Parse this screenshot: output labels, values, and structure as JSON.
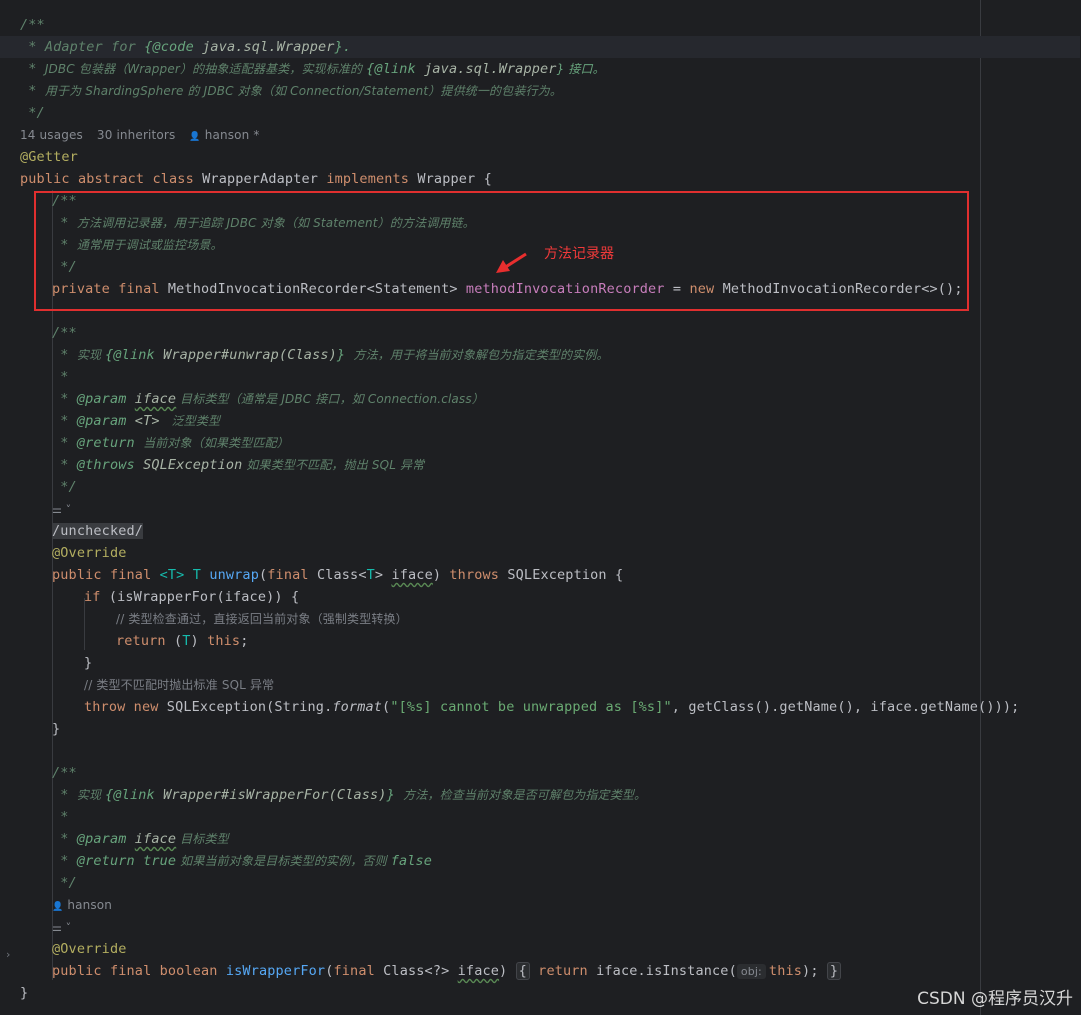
{
  "editor": {
    "language": "java",
    "colors": {
      "background": "#1e1f22",
      "keyword": "#cf8e6d",
      "annotation": "#b3ae60",
      "field": "#c77dbb",
      "method": "#56a8f5",
      "string": "#6aab73",
      "doc_comment": "#5f826b",
      "line_comment": "#7a7e85",
      "highlight_box": "#e02f2f"
    },
    "class_header": {
      "doc_open": "/**",
      "doc_line1_star": " * ",
      "doc_line1_text": "Adapter for ",
      "doc_line1_tag": "{@code ",
      "doc_line1_code": "java.sql.Wrapper",
      "doc_line1_end": "}.",
      "doc_line2_star": " * ",
      "doc_line2_text": "JDBC 包装器（Wrapper）的抽象适配器基类，实现标准的 ",
      "doc_line2_tag": "{@link ",
      "doc_line2_code": "java.sql.Wrapper",
      "doc_line2_end": "} 接口。",
      "doc_line3_star": " * ",
      "doc_line3_text": "用于为 ShardingSphere 的 JDBC 对象（如 Connection/Statement）提供统一的包装行为。",
      "doc_close": " */",
      "usages": "14 usages",
      "inheritors": "30 inheritors",
      "author": "hanson *",
      "annotation": "@Getter",
      "kw_public": "public",
      "kw_abstract": "abstract",
      "kw_class": "class",
      "class_name": "WrapperAdapter",
      "kw_implements": "implements",
      "interface_name": "Wrapper",
      "open_brace": "{"
    },
    "field_block": {
      "doc_open": "/**",
      "doc_line1_star": " * ",
      "doc_line1_text": "方法调用记录器，用于追踪 JDBC 对象（如 Statement）的方法调用链。",
      "doc_line2_star": " * ",
      "doc_line2_text": "通常用于调试或监控场景。",
      "doc_close": " */",
      "kw_private": "private",
      "kw_final": "final",
      "type": "MethodInvocationRecorder<Statement>",
      "field_name": "methodInvocationRecorder",
      "assign": " = ",
      "kw_new": "new",
      "init": "MethodInvocationRecorder<>();"
    },
    "unwrap_method": {
      "doc_open": "/**",
      "doc_l1_star": " * ",
      "doc_l1_text": "实现 ",
      "doc_l1_tag": "{@link ",
      "doc_l1_ref": "Wrapper#",
      "doc_l1_ref_method": "unwrap",
      "doc_l1_ref_param": "(Class)",
      "doc_l1_end": "} ",
      "doc_l1_tail": "方法，用于将当前对象解包为指定类型的实例。",
      "doc_blank": " *",
      "doc_p1_star": " * ",
      "doc_p1_tag": "@param ",
      "doc_p1_name": "iface",
      "doc_p1_desc": " 目标类型（通常是 JDBC 接口，如 Connection.class）",
      "doc_p2_star": " * ",
      "doc_p2_tag": "@param ",
      "doc_p2_name": "<T>",
      "doc_p2_desc": "   泛型类型",
      "doc_r_star": " * ",
      "doc_r_tag": "@return ",
      "doc_r_desc": "当前对象（如果类型匹配）",
      "doc_t_star": " * ",
      "doc_t_tag": "@throws ",
      "doc_t_name": "SQLException",
      "doc_t_desc": " 如果类型不匹配，抛出 SQL 异常",
      "doc_close": " */",
      "lens": "⚌ ˅",
      "suppress": "/unchecked/",
      "annotation": "@Override",
      "kw_public": "public",
      "kw_final": "final",
      "type_param": "<T>",
      "ret_type": "T",
      "name": "unwrap",
      "paren_open": "(",
      "param_kw_final": "final",
      "param_type_a": "Class<",
      "param_type_t": "T",
      "param_type_b": "> ",
      "param_name": "iface",
      "paren_close": ")",
      "kw_throws": "throws",
      "exception": "SQLException {",
      "if_kw": "if",
      "if_cond": " (isWrapperFor(iface)) {",
      "comment1": "// 类型检查通过，直接返回当前对象（强制类型转换）",
      "return_kw": "return",
      "return_cast_a": " (",
      "return_cast_t": "T",
      "return_cast_b": ") ",
      "this_kw": "this",
      "semicolon": ";",
      "close_if": "}",
      "comment2": "// 类型不匹配时抛出标准 SQL 异常",
      "throw_kw": "throw",
      "new_kw": "new",
      "throw_a": "SQLException(String.",
      "throw_format": "format",
      "throw_b": "(",
      "throw_str": "\"[%s] cannot be unwrapped as [%s]\"",
      "throw_c": ", getClass().getName(), iface.getName()));",
      "close_method": "}"
    },
    "is_wrapper_for_method": {
      "doc_open": "/**",
      "doc_l1_star": " * ",
      "doc_l1_text": "实现 ",
      "doc_l1_tag": "{@link ",
      "doc_l1_ref": "Wrapper#",
      "doc_l1_ref_method": "isWrapperFor",
      "doc_l1_ref_param": "(Class)",
      "doc_l1_end": "} ",
      "doc_l1_tail": "方法，检查当前对象是否可解包为指定类型。",
      "doc_blank": " *",
      "doc_p_star": " * ",
      "doc_p_tag": "@param ",
      "doc_p_name": "iface",
      "doc_p_desc": " 目标类型",
      "doc_r_star": " * ",
      "doc_r_tag": "@return ",
      "doc_r_val": "true",
      "doc_r_desc": " 如果当前对象是目标类型的实例，否则 ",
      "doc_r_val2": "false",
      "doc_close": " */",
      "author": "hanson",
      "lens": "⚌ ˅",
      "annotation": "@Override",
      "kw_public": "public",
      "kw_final": "final",
      "kw_boolean": "boolean",
      "name": "isWrapperFor",
      "paren_open": "(",
      "param_kw_final": "final",
      "param_type": "Class<?> ",
      "param_name": "iface",
      "paren_close": ")",
      "fold_open": "{",
      "return_kw": "return",
      "return_call": " iface.isInstance(",
      "hint": "obj:",
      "this_kw": "this",
      "return_end": ");",
      "fold_close": "}"
    },
    "class_close": "}"
  },
  "annotation": {
    "label": "方法记录器"
  },
  "watermark": "CSDN @程序员汉升"
}
